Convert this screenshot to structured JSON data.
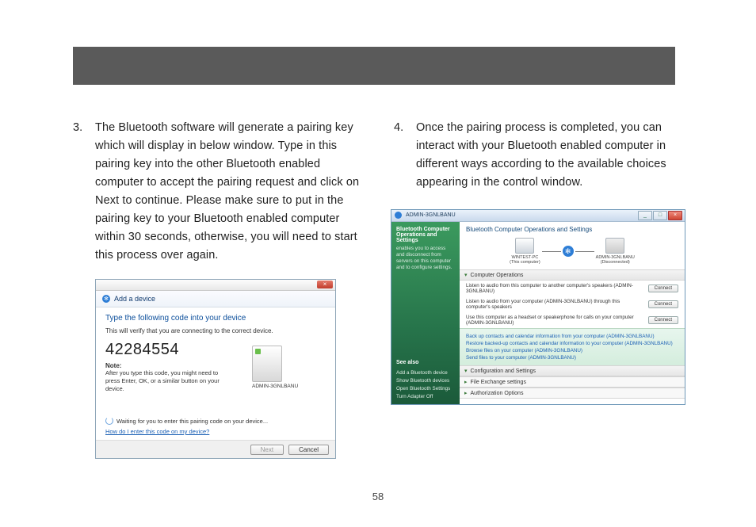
{
  "page_number": "58",
  "col1": {
    "num": "3.",
    "text": "The Bluetooth software will generate a pairing key which will display in below window.  Type in this pairing key into the other Bluetooth enabled computer to accept the pairing request and click on Next to continue.  Please make sure to put in the pairing key to your Bluetooth enabled computer within 30 seconds, otherwise, you will need to start this process over again."
  },
  "col2": {
    "num": "4.",
    "text": "Once the pairing process is completed, you can interact with your Bluetooth enabled computer in different ways according to the available choices appearing in the control window."
  },
  "shot1": {
    "close": "×",
    "header": "Add a device",
    "prompt": "Type the following code into your device",
    "verify": "This will verify that you are connecting to the correct device.",
    "code": "42284554",
    "device_name": "ADMIN-3GNLBANU",
    "note_h": "Note:",
    "note": "After you type this code, you might need to press Enter, OK, or a similar button on your device.",
    "waiting": "Waiting for you to enter this pairing code on your device...",
    "link": "How do I enter this code on my device?",
    "btn_next": "Next",
    "btn_cancel": "Cancel"
  },
  "shot2": {
    "title": "ADMIN-3GNLBANU",
    "side_title": "Bluetooth Computer Operations and Settings",
    "side_desc": "enables you to access and disconnect from servers on this computer and to configure settings.",
    "see_also": "See also",
    "side_links": [
      "Add a Bluetooth device",
      "Show Bluetooth devices",
      "Open Bluetooth Settings",
      "Turn Adapter Off"
    ],
    "main_title": "Bluetooth Computer Operations and Settings",
    "pc1_name": "WINTEST-PC",
    "pc1_sub": "(This computer)",
    "pc2_name": "ADMIN-3GNLBANU",
    "pc2_sub": "(Disconnected)",
    "sect_ops": "Computer Operations",
    "op1": "Listen to audio from this computer to another computer's speakers (ADMIN-3GNLBANU)",
    "op2": "Listen to audio from your computer (ADMIN-3GNLBANU) through this computer's speakers",
    "op3": "Use this computer as a headset or speakerphone for calls on your computer (ADMIN-3GNLBANU)",
    "connect": "Connect",
    "link1": "Back up contacts and calendar information from your computer (ADMIN-3GNLBANU)",
    "link2": "Restore backed-up contacts and calendar information to your computer (ADMIN-3GNLBANU)",
    "link3": "Browse files on your computer (ADMIN-3GNLBANU)",
    "link4": "Send files to your computer (ADMIN-3GNLBANU)",
    "sect_conf": "Configuration and Settings",
    "sub1": "File Exchange settings",
    "sub2": "Authorization Options"
  }
}
